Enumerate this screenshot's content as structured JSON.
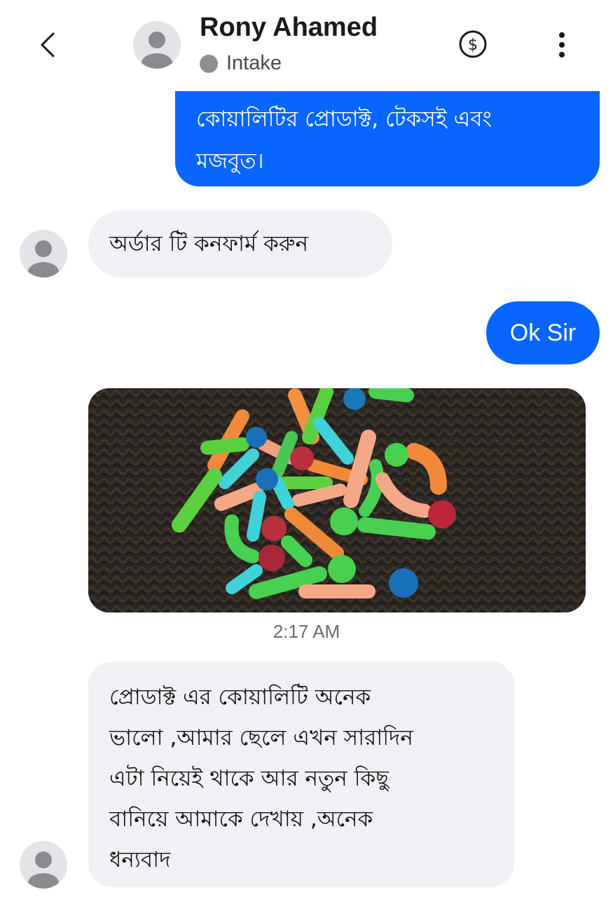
{
  "header": {
    "contact_name": "Rony Ahamed",
    "status": "Intake",
    "icons": [
      "back-chevron-icon",
      "avatar",
      "dollar-icon",
      "more-vertical-icon"
    ]
  },
  "messages": [
    {
      "direction": "outgoing",
      "text": "কোয়ালিটির প্রোডাক্ট, টেকসই এবং\nমজবুত।"
    },
    {
      "direction": "incoming",
      "text": "অর্ডার টি কনফার্ম করুন"
    },
    {
      "direction": "outgoing",
      "text": "Ok Sir"
    },
    {
      "direction": "incoming",
      "type": "photo",
      "description_icon": "photo-magnetic-sticks-toy"
    },
    {
      "direction": "incoming",
      "text": "প্রোডাক্ট এর কোয়ালিটি অনেক\nভালো ,আমার ছেলে এখন সারাদিন\nএটা নিয়েই থাকে আর নতুন কিছু\nবানিয়ে আমাকে দেখায় ,অনেক\nধন্যবাদ"
    }
  ],
  "timestamp": "2:17 AM",
  "colors": {
    "outgoing_bubble": "#0866ff",
    "incoming_bubble": "#f0f1f5",
    "status_dot": "#8e8e93"
  }
}
